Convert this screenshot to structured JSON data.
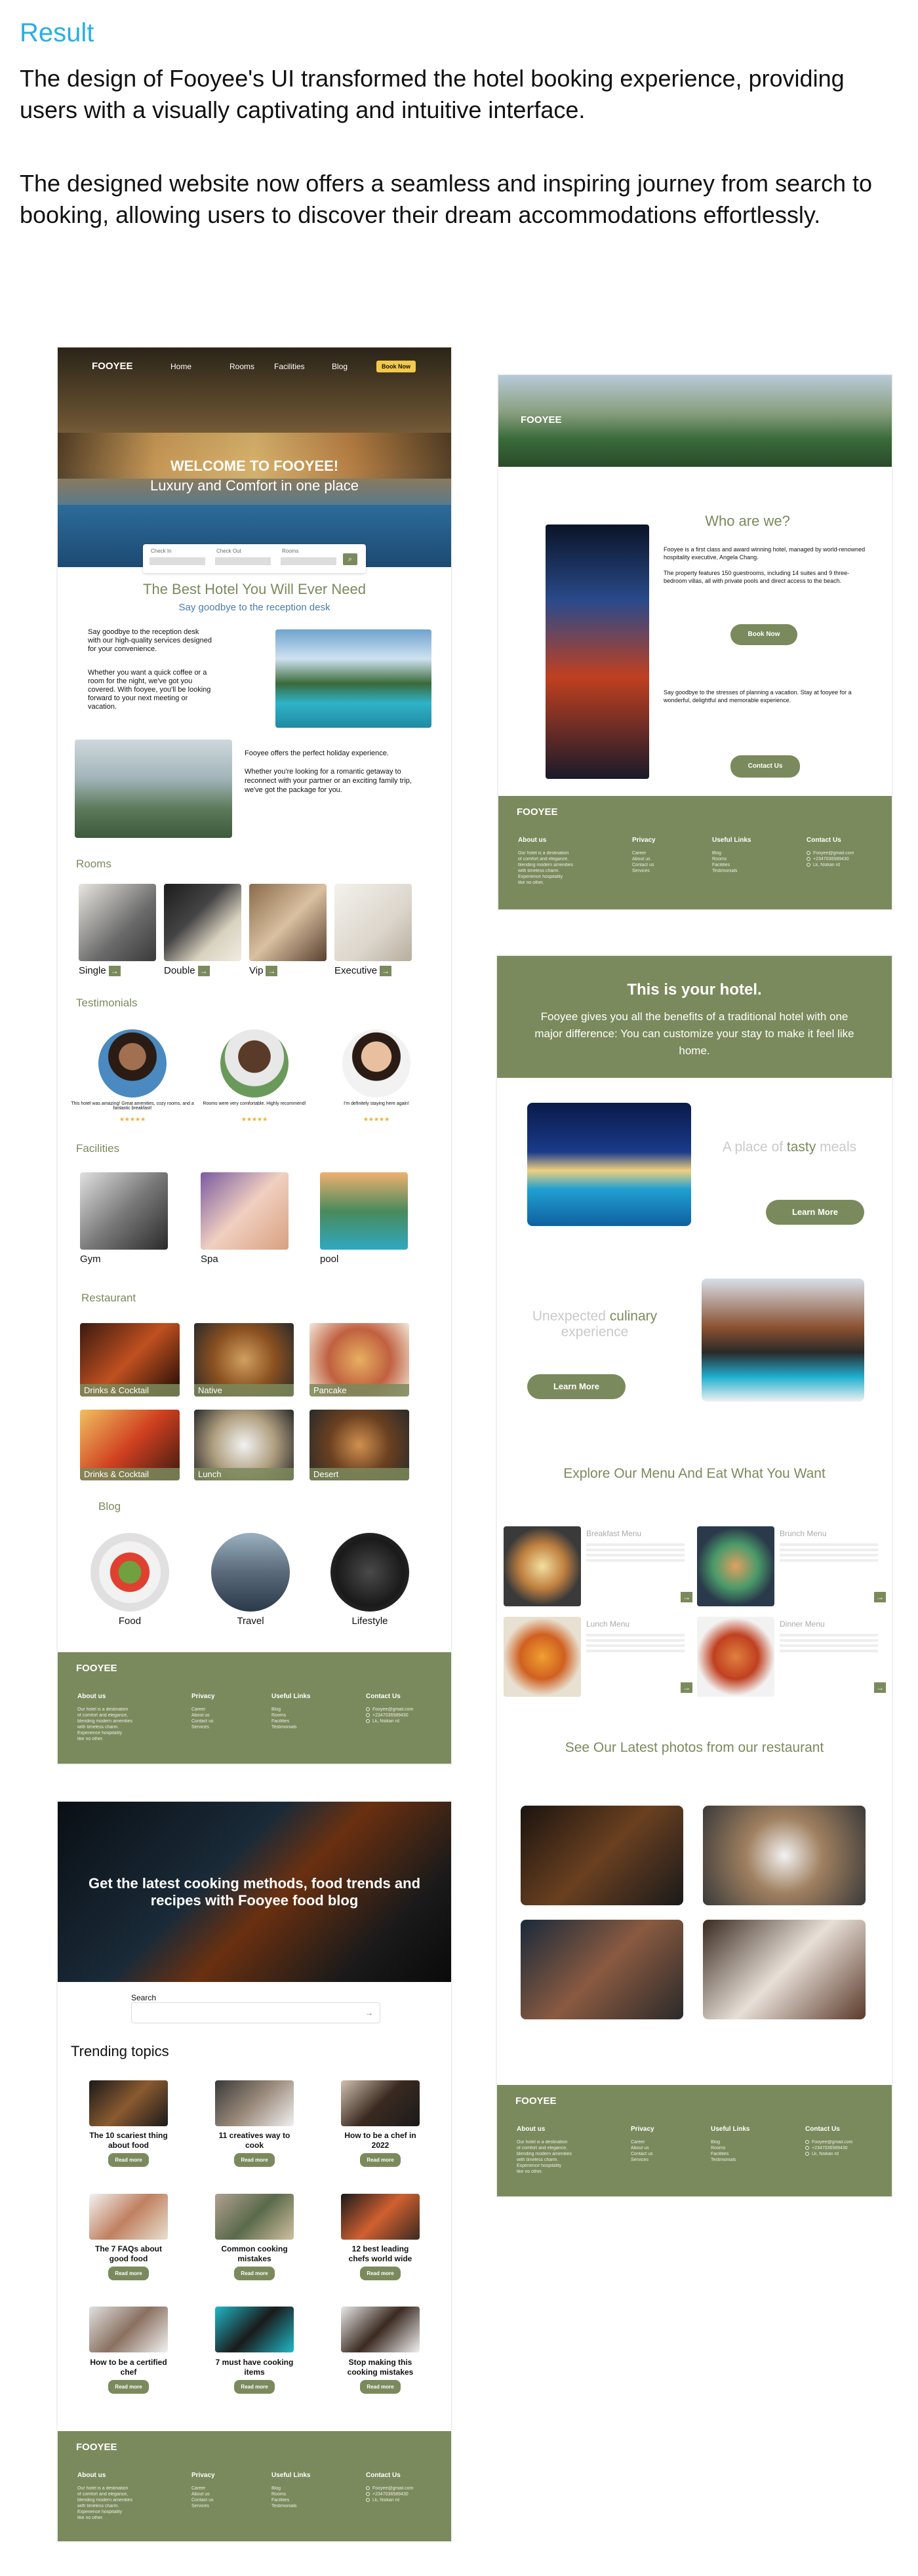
{
  "heading": {
    "title": "Result",
    "p1": "The design of Fooyee's UI transformed the hotel booking experience, providing users with a visually captivating and intuitive interface.",
    "p2": "The designed website now offers a seamless and inspiring journey from search to booking, allowing users to discover their dream accommodations effortlessly."
  },
  "home": {
    "brand": "FOOYEE",
    "nav": [
      "Home",
      "Rooms",
      "Facilities",
      "Blog"
    ],
    "cta": "Book Now",
    "hero_title": "WELCOME TO FOOYEE!",
    "hero_sub": "Luxury and Comfort in one place",
    "search": {
      "fields": [
        "Check In",
        "Check Out",
        "Rooms"
      ]
    },
    "best_title": "The Best Hotel You Will Ever Need",
    "best_sub": "Say goodbye to the reception desk",
    "p1": "Say goodbye to the reception desk with our high-quality services designed for your convenience.",
    "p2": "Whether you want a quick coffee or a room for the night, we've got you covered. With fooyee, you'll be looking forward to your next meeting or vacation.",
    "p3": "Fooyee offers the perfect holiday experience.",
    "p4": "Whether you're looking for a romantic getaway to reconnect with your partner or an exciting family trip, we've got the package for you.",
    "rooms_title": "Rooms",
    "rooms": [
      "Single",
      "Double",
      "Vip",
      "Executive"
    ],
    "testimonials_title": "Testimonials",
    "testimonials": [
      "This hotel was amazing! Great amenities, cozy rooms, and a fantastic breakfast!",
      "Rooms were very comfortable. Highly recommend!",
      "I'm definitely staying here again!"
    ],
    "stars": "★★★★★",
    "facilities_title": "Facilities",
    "facilities": [
      "Gym",
      "Spa",
      "pool"
    ],
    "restaurant_title": "Restaurant",
    "restaurant": [
      "Drinks & Cocktail",
      "Native",
      "Pancake",
      "Drinks & Cocktail",
      "Lunch",
      "Desert"
    ],
    "blog_title": "Blog",
    "blog": [
      "Food",
      "Travel",
      "Lifestyle"
    ]
  },
  "footer": {
    "brand": "FOOYEE",
    "cols": [
      "About us",
      "Privacy",
      "Useful Links",
      "Contact Us"
    ],
    "about": [
      "Our hotel is a destination",
      "of comfort and elegance,",
      "blending modern amenities",
      "with timeless charm.",
      "Experience hospitality",
      "like no other."
    ],
    "privacy": [
      "Career",
      "About us",
      "Contact us",
      "Services"
    ],
    "links": [
      "Blog",
      "Rooms",
      "Facilities",
      "Testimonials"
    ],
    "contact": [
      "Fooyee@gmail.com",
      "+2347036589430",
      "Lk, Nsikan rd"
    ]
  },
  "blogpage": {
    "hero": "Get the latest cooking methods, food trends and recipes with Fooyee food blog",
    "search_label": "Search",
    "trending": "Trending topics",
    "read": "Read more",
    "topics": [
      "The 10 scariest thing about food",
      "11 creatives way to cook",
      "How to be a chef in 2022",
      "The 7 FAQs about good food",
      "Common cooking mistakes",
      "12 best leading chefs world wide",
      "How to be a certified chef",
      "7 must have cooking items",
      "Stop making this cooking mistakes"
    ]
  },
  "about": {
    "brand": "FOOYEE",
    "title": "Who are we?",
    "p1": "Fooyee is a first class and award winning hotel, managed by world-renowned hospitality executive, Angela Chang.",
    "p2": "The property features 150 guestrooms, including 14 suites and 9 three-bedroom villas, all with private pools and direct access to the beach.",
    "book": "Book Now",
    "p3": "Say goodbye to the stresses of planning a vacation. Stay at fooyee for a wonderful, delightful and memorable experience.",
    "contact": "Contact Us"
  },
  "hotel": {
    "title": "This is your hotel.",
    "sub": "Fooyee gives you all the benefits of a traditional hotel with one major difference: You can customize your stay to make it feel like home.",
    "meals_a": "A place of ",
    "meals_b": "tasty",
    "meals_c": " meals",
    "learn": "Learn More",
    "exp_a": "Unexpected ",
    "exp_b": "culinary",
    "exp_c": " experience",
    "menu_title": "Explore Our Menu And Eat What You Want",
    "menus": [
      "Breakfast Menu",
      "Brunch Menu",
      "Lunch Menu",
      "Dinner Menu"
    ],
    "photos_title": "See Our Latest photos from our restaurant"
  },
  "colors": {
    "accent": "#29aee6",
    "brand": "#7b8a5c"
  }
}
